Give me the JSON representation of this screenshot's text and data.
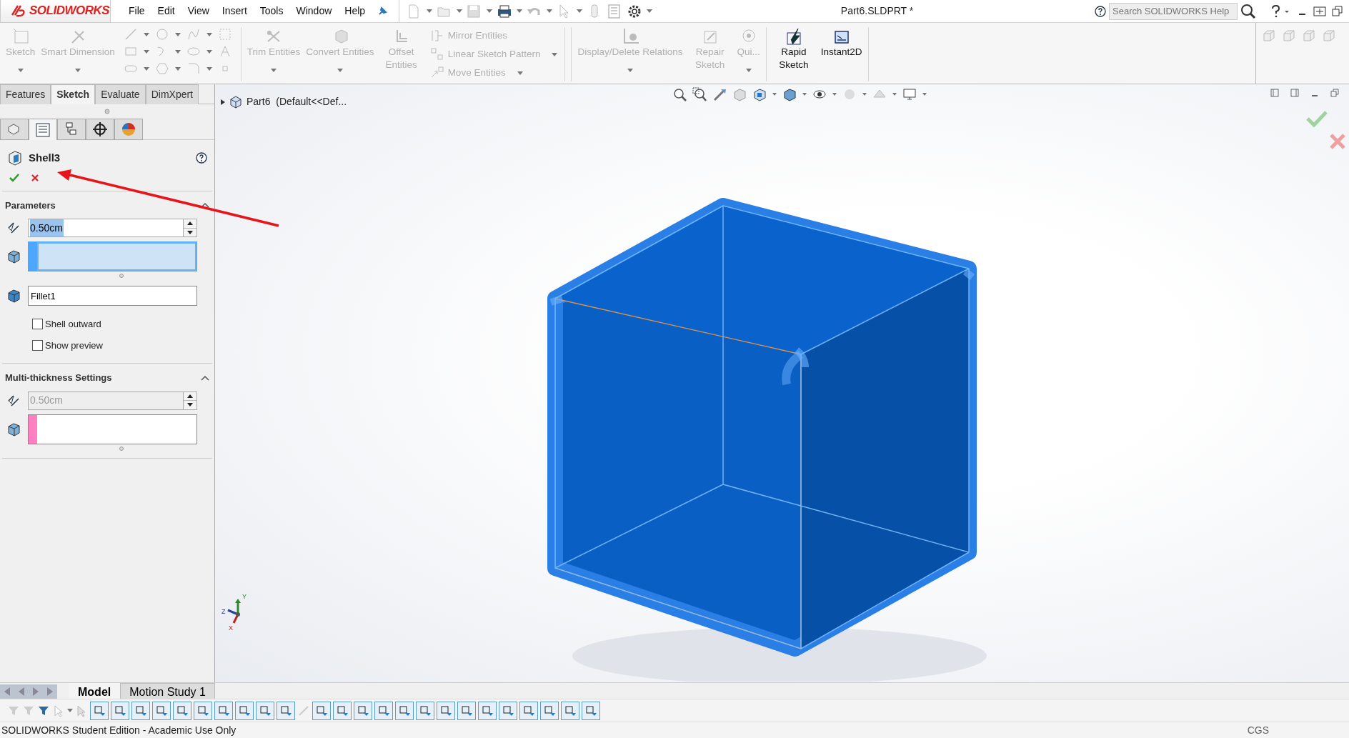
{
  "title_bar": {
    "app_name": "SOLIDWORKS",
    "menu": [
      "File",
      "Edit",
      "View",
      "Insert",
      "Tools",
      "Window",
      "Help"
    ],
    "document_title": "Part6.SLDPRT *",
    "search": {
      "placeholder": "Search SOLIDWORKS Help"
    }
  },
  "ribbon": {
    "tools": [
      {
        "label": "Sketch",
        "kind": "large",
        "disabled": true,
        "has_menu": true
      },
      {
        "label": "Smart Dimension",
        "kind": "large",
        "disabled": true,
        "has_menu": true
      },
      {
        "label": "Trim Entities",
        "kind": "large",
        "disabled": true,
        "has_menu": true
      },
      {
        "label": "Convert Entities",
        "kind": "large",
        "disabled": true,
        "has_menu": true
      },
      {
        "label": "Offset Entities",
        "kind": "tall",
        "disabled": true,
        "has_menu": false
      },
      {
        "label": "Mirror Entities",
        "kind": "small",
        "disabled": true,
        "has_menu": false
      },
      {
        "label": "Linear Sketch Pattern",
        "kind": "small",
        "disabled": true,
        "has_menu": true
      },
      {
        "label": "Move Entities",
        "kind": "small",
        "disabled": true,
        "has_menu": true
      },
      {
        "label": "Display/Delete Relations",
        "kind": "large",
        "disabled": true,
        "has_menu": true
      },
      {
        "label": "Repair Sketch",
        "kind": "tall",
        "disabled": true,
        "has_menu": false
      },
      {
        "label": "Qui...",
        "kind": "large",
        "disabled": true,
        "has_menu": true
      },
      {
        "label": "Rapid Sketch",
        "kind": "tall",
        "disabled": false,
        "has_menu": false
      },
      {
        "label": "Instant2D",
        "kind": "large",
        "disabled": false,
        "has_menu": false
      }
    ]
  },
  "command_tabs": [
    {
      "label": "Features",
      "selected": false
    },
    {
      "label": "Sketch",
      "selected": true
    },
    {
      "label": "Evaluate",
      "selected": false
    },
    {
      "label": "DimXpert",
      "selected": false
    }
  ],
  "manager_tabs": [
    {
      "selected": false
    },
    {
      "selected": true
    },
    {
      "selected": false
    },
    {
      "selected": false
    },
    {
      "selected": false
    }
  ],
  "property_manager": {
    "title": "Shell3",
    "sections": [
      {
        "title": "Parameters",
        "expanded": true,
        "thickness": {
          "value": "0.50cm",
          "disabled": false,
          "selected": true
        },
        "faces": {
          "color": "#4da6ff",
          "active": true
        },
        "bodies": {
          "value": "Fillet1"
        },
        "options": [
          {
            "label": "Shell outward",
            "checked": false
          },
          {
            "label": "Show preview",
            "checked": false
          }
        ]
      },
      {
        "title": "Multi-thickness Settings",
        "expanded": true,
        "thickness": {
          "value": "0.50cm",
          "disabled": true,
          "selected": false
        },
        "faces": {
          "color": "#ff80c0",
          "active": false
        }
      }
    ]
  },
  "viewport": {
    "tree_item": "Part6  (Default<<Def...",
    "triad_labels": [
      "Y",
      "Z",
      "X"
    ]
  },
  "bottom_tabs": [
    {
      "label": "Model",
      "selected": true
    },
    {
      "label": "Motion Study 1",
      "selected": false
    }
  ],
  "status_bar": {
    "text": "SOLIDWORKS Student Edition - Academic Use Only",
    "units": "CGS"
  }
}
